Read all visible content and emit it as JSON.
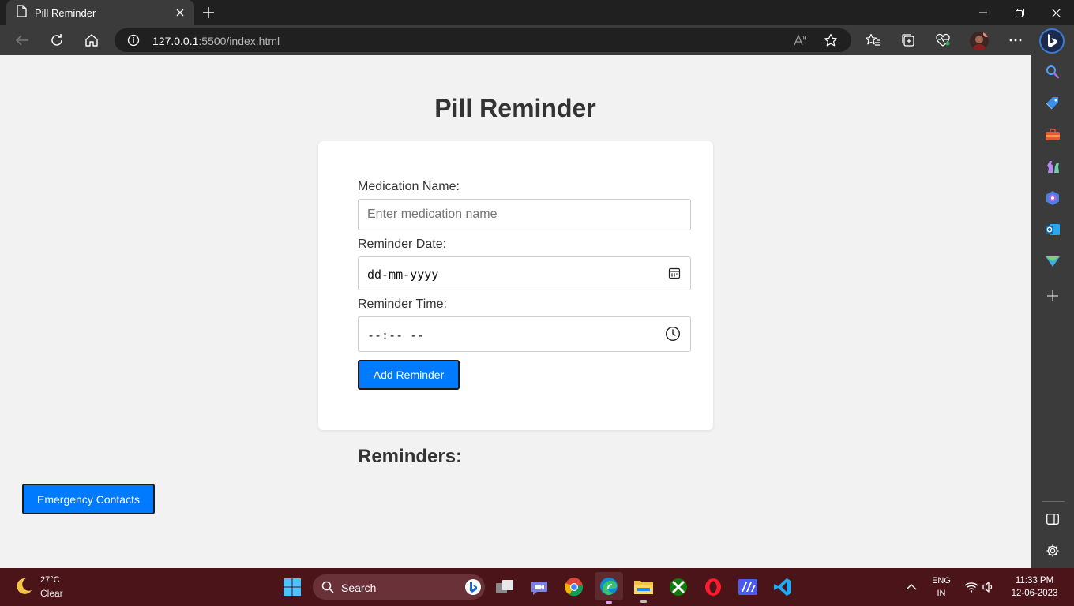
{
  "browser": {
    "tab_title": "Pill Reminder",
    "url_host": "127.0.0.1",
    "url_rest": ":5500/index.html"
  },
  "page": {
    "title": "Pill Reminder",
    "form": {
      "medication_label": "Medication Name:",
      "medication_placeholder": "Enter medication name",
      "date_label": "Reminder Date:",
      "date_value": "dd-mm-yyyy",
      "time_label": "Reminder Time:",
      "time_value": "--:-- --",
      "add_button": "Add Reminder"
    },
    "reminders_heading": "Reminders:",
    "emergency_button": "Emergency Contacts"
  },
  "taskbar": {
    "weather_temp": "27°C",
    "weather_condition": "Clear",
    "search_label": "Search",
    "language_top": "ENG",
    "language_bottom": "IN",
    "time": "11:33 PM",
    "date": "12-06-2023"
  },
  "colors": {
    "primary_button": "#007bff",
    "page_background": "#f2f2f2",
    "taskbar": "#4a1418"
  }
}
